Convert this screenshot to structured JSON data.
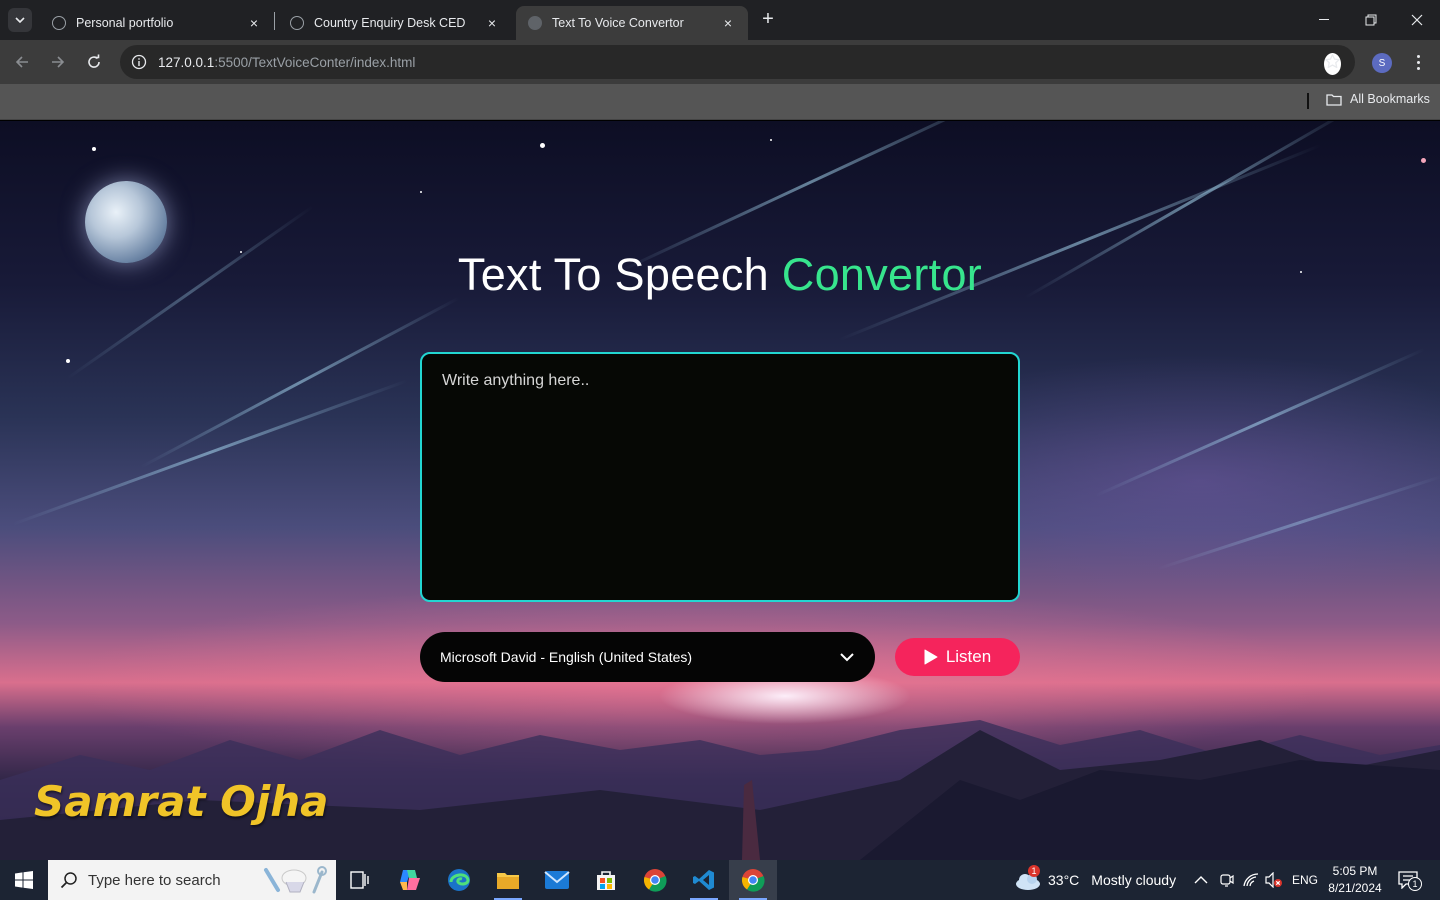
{
  "browser": {
    "tabs": [
      {
        "title": "Personal portfolio",
        "close": "×"
      },
      {
        "title": "Country Enquiry Desk CED",
        "close": "×"
      },
      {
        "title": "Text To Voice Convertor",
        "close": "×"
      }
    ],
    "new_tab": "+",
    "url_host": "127.0.0.1",
    "url_rest": ":5500/TextVoiceConter/index.html",
    "profile_initial": "S",
    "bookmarks_label": "All Bookmarks"
  },
  "page": {
    "title_white": "Text To Speech",
    "title_green": "Convertor",
    "textarea_placeholder": "Write anything here..",
    "voice_selected": "Microsoft David - English (United States)",
    "listen_label": "Listen",
    "signature": "Samrat Ojha"
  },
  "taskbar": {
    "search_placeholder": "Type here to search",
    "weather_badge": "1",
    "weather_temp": "33°C",
    "weather_text": "Mostly cloudy",
    "language": "ENG",
    "time": "5:05 PM",
    "date": "8/21/2024",
    "notification_count": "1"
  },
  "colors": {
    "accent_green": "#37e58d",
    "textarea_border": "#22d6d2",
    "listen_button": "#f5245c",
    "signature": "#f0c428"
  }
}
